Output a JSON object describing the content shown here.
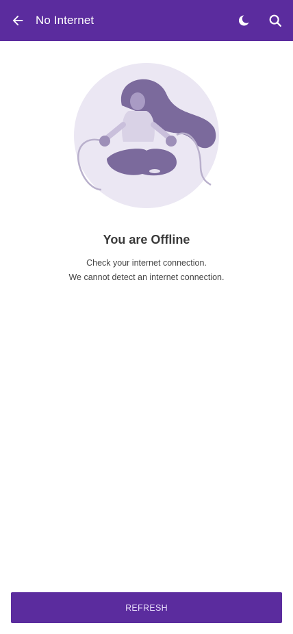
{
  "appbar": {
    "title": "No Internet",
    "back_icon": "arrow-left-icon",
    "theme_icon": "moon-icon",
    "search_icon": "search-icon"
  },
  "offline": {
    "heading": "You are Offline",
    "line1": "Check your internet connection.",
    "line2": "We cannot detect an internet connection.",
    "illustration": "unplugged-meditation-illustration"
  },
  "actions": {
    "refresh_label": "REFRESH"
  },
  "colors": {
    "primary": "#5b2c9e",
    "illustration_bg": "#ebe7f3",
    "illustration_fg": "#7b6a9c"
  }
}
